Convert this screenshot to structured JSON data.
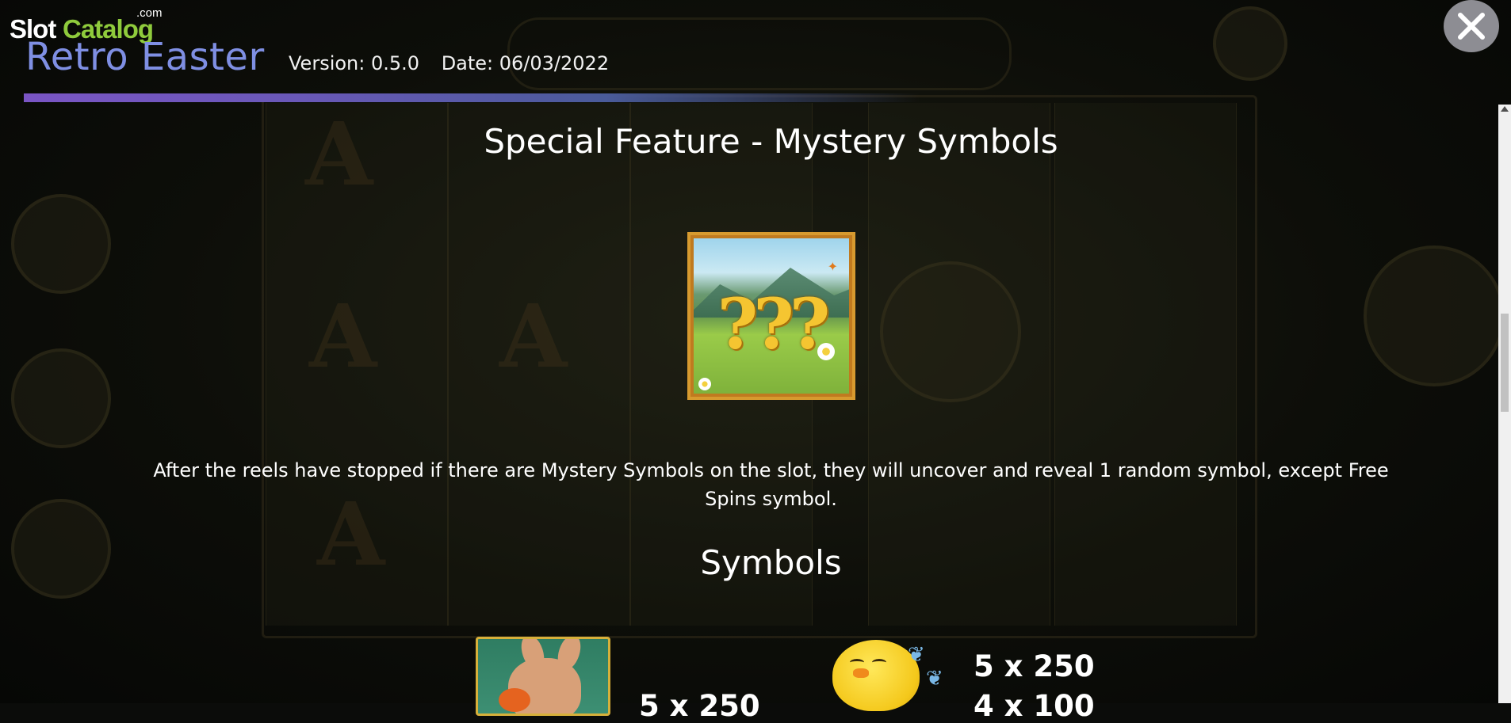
{
  "logo": {
    "slot": "Slot",
    "catalog": "Catalog",
    "com": ".com",
    "brand_green": "#8fcb3c"
  },
  "header": {
    "title": "Retro Easter",
    "version": "Version: 0.5.0",
    "date": "Date: 06/03/2022",
    "title_color": "#7f8fe3"
  },
  "close_button": {
    "icon": "close-icon"
  },
  "feature": {
    "heading": "Special Feature - Mystery Symbols",
    "symbol_icon": "mystery-symbol-icon",
    "description": "After the reels have stopped if there are Mystery Symbols on the slot, they will uncover and reveal 1 random symbol, except Free Spins symbol."
  },
  "symbols": {
    "heading": "Symbols",
    "items": [
      {
        "icon": "rabbit-symbol-icon",
        "payouts": [
          "5 x 250"
        ]
      },
      {
        "icon": "chick-symbol-icon",
        "payouts": [
          "5 x 250",
          "4 x 100"
        ]
      }
    ]
  }
}
